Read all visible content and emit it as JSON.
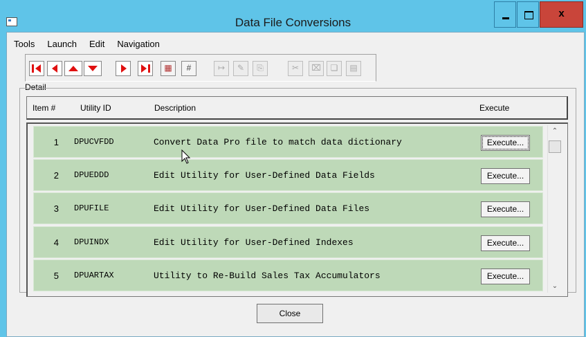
{
  "window": {
    "title": "Data File Conversions",
    "controls": {
      "minimize_icon": "minimize-icon",
      "maximize_icon": "maximize-icon",
      "close_glyph": "x"
    },
    "colors": {
      "titlebar": "#5fc4e8",
      "close": "#c9453a",
      "row_bg": "#bed9b8",
      "nav_red": "#e01010"
    }
  },
  "menubar": {
    "items": [
      "Tools",
      "Launch",
      "Edit",
      "Navigation"
    ]
  },
  "toolbar": {
    "buttons": [
      {
        "icon": "first-record-icon"
      },
      {
        "icon": "previous-record-icon"
      },
      {
        "icon": "scroll-up-icon"
      },
      {
        "icon": "scroll-down-icon"
      },
      {
        "icon": "next-record-icon"
      },
      {
        "icon": "last-record-icon"
      },
      {
        "icon": "find-icon"
      },
      {
        "icon": "grid-view-icon"
      },
      {
        "icon": "insert-icon"
      },
      {
        "icon": "edit-icon"
      },
      {
        "icon": "attach-icon"
      },
      {
        "icon": "cut-icon"
      },
      {
        "icon": "delete-icon"
      },
      {
        "icon": "copy-icon"
      },
      {
        "icon": "paste-icon"
      }
    ]
  },
  "detail": {
    "label": "Detail",
    "columns": {
      "item": "Item #",
      "utility": "Utility ID",
      "description": "Description",
      "execute": "Execute"
    },
    "rows": [
      {
        "num": "1",
        "id": "DPUCVFDD",
        "desc": "Convert Data Pro file to match data dictionary",
        "button": "Execute..."
      },
      {
        "num": "2",
        "id": "DPUEDDD",
        "desc": "Edit Utility for User-Defined Data Fields",
        "button": "Execute..."
      },
      {
        "num": "3",
        "id": "DPUFILE",
        "desc": "Edit Utility for User-Defined Data Files",
        "button": "Execute..."
      },
      {
        "num": "4",
        "id": "DPUINDX",
        "desc": "Edit Utility for User-Defined Indexes",
        "button": "Execute..."
      },
      {
        "num": "5",
        "id": "DPUARTAX",
        "desc": "Utility to Re-Build Sales Tax Accumulators",
        "button": "Execute..."
      }
    ]
  },
  "footer": {
    "close_label": "Close"
  }
}
